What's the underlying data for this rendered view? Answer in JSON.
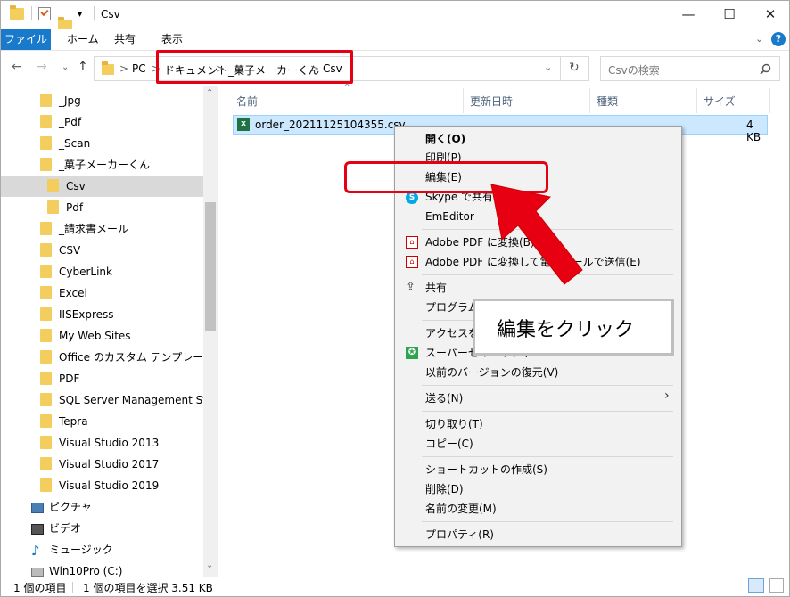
{
  "window": {
    "title": "Csv",
    "controls": {
      "minimize": "—",
      "maximize": "☐",
      "close": "✕"
    }
  },
  "ribbon": {
    "tabs": [
      "ファイル",
      "ホーム",
      "共有",
      "表示"
    ]
  },
  "address": {
    "items": [
      "PC",
      ">",
      "ドキュメント",
      ">",
      "_菓子メーカーくん",
      ">",
      "Csv"
    ],
    "search_placeholder": "Csvの検索"
  },
  "nav": {
    "items": [
      "_Jpg",
      "_Pdf",
      "_Scan",
      "_菓子メーカーくん",
      "Csv",
      "Pdf",
      "_請求書メール",
      "CSV",
      "CyberLink",
      "Excel",
      "IISExpress",
      "My Web Sites",
      "Office のカスタム テンプレート",
      "PDF",
      "SQL Server Management Studio",
      "Tepra",
      "Visual Studio 2013",
      "Visual Studio 2017",
      "Visual Studio 2019",
      "ピクチャ",
      "ビデオ",
      "ミュージック",
      "Win10Pro (C:)"
    ],
    "selected": "Csv"
  },
  "list": {
    "columns": [
      "名前",
      "更新日時",
      "種類",
      "サイズ"
    ],
    "files": [
      {
        "name": "order_20211125104355.csv",
        "size": "4 KB"
      }
    ]
  },
  "context_menu": {
    "items": [
      "開く(O)",
      "印刷(P)",
      "編集(E)",
      "Skype で共有",
      "EmEditor",
      "Adobe PDF に変換(B)",
      "Adobe PDF に変換して電子メールで送信(E)",
      "共有",
      "プログラムから開く(H)",
      "アクセスを許可する(G)",
      "スーパーセキュリティ",
      "以前のバージョンの復元(V)",
      "送る(N)",
      "切り取り(T)",
      "コピー(C)",
      "ショートカットの作成(S)",
      "削除(D)",
      "名前の変更(M)",
      "プロパティ(R)"
    ]
  },
  "callout": {
    "text": "編集をクリック"
  },
  "status": {
    "count": "1 個の項目",
    "selected": "1 個の項目を選択  3.51 KB"
  },
  "colors": {
    "accent": "#1979ca",
    "highlight": "#e60012",
    "selection": "#cce8ff"
  }
}
